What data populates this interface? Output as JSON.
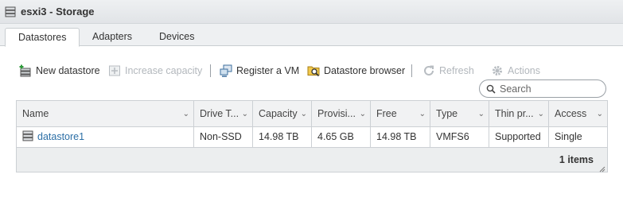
{
  "window": {
    "title": "esxi3 - Storage"
  },
  "tabs": [
    {
      "label": "Datastores",
      "active": true
    },
    {
      "label": "Adapters",
      "active": false
    },
    {
      "label": "Devices",
      "active": false
    }
  ],
  "toolbar": {
    "new_datastore": "New datastore",
    "increase_capacity": "Increase capacity",
    "register_vm": "Register a VM",
    "datastore_browser": "Datastore browser",
    "refresh": "Refresh",
    "actions": "Actions"
  },
  "search": {
    "placeholder": "Search"
  },
  "table": {
    "columns": [
      "Name",
      "Drive Type",
      "Capacity",
      "Provisioned",
      "Free",
      "Type",
      "Thin provisioning",
      "Access"
    ],
    "column_display": [
      "Name",
      "Drive T...",
      "Capacity",
      "Provisi...",
      "Free",
      "Type",
      "Thin pr...",
      "Access"
    ],
    "rows": [
      {
        "name": "datastore1",
        "drive_type": "Non-SSD",
        "capacity": "14.98 TB",
        "provisioned": "4.65 GB",
        "free": "14.98 TB",
        "type": "VMFS6",
        "thin_provisioning": "Supported",
        "access": "Single"
      }
    ],
    "footer": "1 items"
  },
  "colors": {
    "link": "#2c6fa6",
    "disabled": "#b2b7bc",
    "border": "#ccd0d4"
  }
}
